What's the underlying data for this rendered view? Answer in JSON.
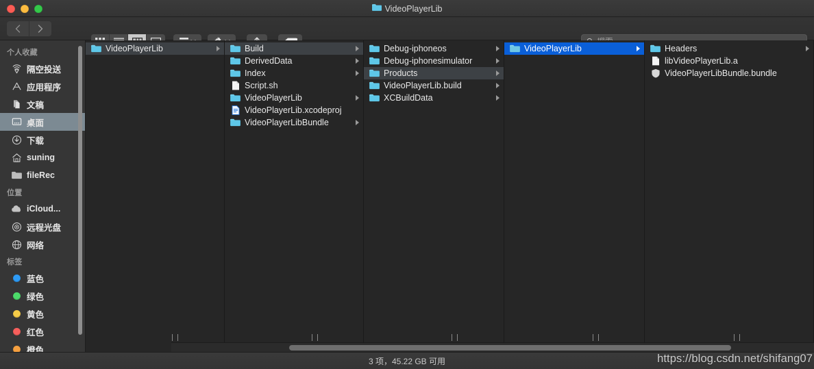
{
  "window": {
    "title": "VideoPlayerLib",
    "traffic_lights": [
      {
        "name": "close",
        "color": "#fc5c54"
      },
      {
        "name": "minimize",
        "color": "#fdbc40"
      },
      {
        "name": "zoom",
        "color": "#34c84a"
      }
    ]
  },
  "toolbar": {
    "back_label": "‹",
    "forward_label": "›",
    "view_modes": [
      {
        "name": "icon-view",
        "active": false
      },
      {
        "name": "list-view",
        "active": false
      },
      {
        "name": "column-view",
        "active": true
      },
      {
        "name": "gallery-view",
        "active": false
      }
    ],
    "arrange_label": "",
    "action_label": "",
    "share_label": "",
    "tags_label": "",
    "search_placeholder": "搜索",
    "search_value": ""
  },
  "sidebar": {
    "sections": [
      {
        "header": "个人收藏",
        "items": [
          {
            "label": "隔空投送",
            "icon": "airdrop-icon",
            "selected": false
          },
          {
            "label": "应用程序",
            "icon": "applications-icon",
            "selected": false
          },
          {
            "label": "文稿",
            "icon": "documents-icon",
            "selected": false
          },
          {
            "label": "桌面",
            "icon": "desktop-icon",
            "selected": true
          },
          {
            "label": "下载",
            "icon": "downloads-icon",
            "selected": false
          },
          {
            "label": "suning",
            "icon": "home-icon",
            "selected": false
          },
          {
            "label": "fileRec",
            "icon": "folder-icon",
            "selected": false
          }
        ]
      },
      {
        "header": "位置",
        "items": [
          {
            "label": "iCloud...",
            "icon": "icloud-icon",
            "selected": false
          },
          {
            "label": "远程光盘",
            "icon": "disc-icon",
            "selected": false
          },
          {
            "label": "网络",
            "icon": "network-icon",
            "selected": false
          }
        ]
      },
      {
        "header": "标签",
        "items": [
          {
            "label": "蓝色",
            "icon": "tag-dot-icon",
            "color": "#2e9bf5",
            "selected": false
          },
          {
            "label": "绿色",
            "icon": "tag-dot-icon",
            "color": "#4cdb6a",
            "selected": false
          },
          {
            "label": "黄色",
            "icon": "tag-dot-icon",
            "color": "#f6cc48",
            "selected": false
          },
          {
            "label": "红色",
            "icon": "tag-dot-icon",
            "color": "#f65f5c",
            "selected": false
          },
          {
            "label": "橙色",
            "icon": "tag-dot-icon",
            "color": "#f5a040",
            "selected": false
          }
        ]
      }
    ]
  },
  "columns": [
    {
      "name": "column-1",
      "rows": [
        {
          "label": "VideoPlayerLib",
          "icon": "folder-icon",
          "has_chevron": true,
          "selection": "gray"
        }
      ]
    },
    {
      "name": "column-2",
      "rows": [
        {
          "label": "Build",
          "icon": "folder-icon",
          "has_chevron": true,
          "selection": "gray"
        },
        {
          "label": "DerivedData",
          "icon": "folder-icon",
          "has_chevron": true,
          "selection": "none"
        },
        {
          "label": "Index",
          "icon": "folder-icon",
          "has_chevron": true,
          "selection": "none"
        },
        {
          "label": "Script.sh",
          "icon": "file-icon",
          "has_chevron": false,
          "selection": "none"
        },
        {
          "label": "VideoPlayerLib",
          "icon": "folder-icon",
          "has_chevron": true,
          "selection": "none"
        },
        {
          "label": "VideoPlayerLib.xcodeproj",
          "icon": "xcodeproj-icon",
          "has_chevron": false,
          "selection": "none"
        },
        {
          "label": "VideoPlayerLibBundle",
          "icon": "folder-icon",
          "has_chevron": true,
          "selection": "none"
        }
      ]
    },
    {
      "name": "column-3",
      "rows": [
        {
          "label": "Debug-iphoneos",
          "icon": "folder-icon",
          "has_chevron": true,
          "selection": "none"
        },
        {
          "label": "Debug-iphonesimulator",
          "icon": "folder-icon",
          "has_chevron": true,
          "selection": "none"
        },
        {
          "label": "Products",
          "icon": "folder-icon",
          "has_chevron": true,
          "selection": "gray"
        },
        {
          "label": "VideoPlayerLib.build",
          "icon": "folder-icon",
          "has_chevron": true,
          "selection": "none"
        },
        {
          "label": "XCBuildData",
          "icon": "folder-icon",
          "has_chevron": true,
          "selection": "none"
        }
      ]
    },
    {
      "name": "column-4",
      "rows": [
        {
          "label": "VideoPlayerLib",
          "icon": "folder-icon",
          "has_chevron": true,
          "selection": "blue"
        }
      ]
    },
    {
      "name": "column-5",
      "rows": [
        {
          "label": "Headers",
          "icon": "folder-icon",
          "has_chevron": true,
          "selection": "none"
        },
        {
          "label": "libVideoPlayerLib.a",
          "icon": "file-icon",
          "has_chevron": false,
          "selection": "none"
        },
        {
          "label": "VideoPlayerLibBundle.bundle",
          "icon": "bundle-icon",
          "has_chevron": false,
          "selection": "none"
        }
      ]
    }
  ],
  "statusbar": {
    "text": "3 项，45.22 GB 可用"
  },
  "watermark": {
    "text": "https://blog.csdn.net/shifang07"
  },
  "colors": {
    "selection_blue": "#0a5fd8",
    "selection_gray": "#3d4145",
    "sidebar_selection": "#7c8a93",
    "folder_blue": "#5ec7e8",
    "window_bg": "#262626",
    "sidebar_bg": "#363636"
  }
}
